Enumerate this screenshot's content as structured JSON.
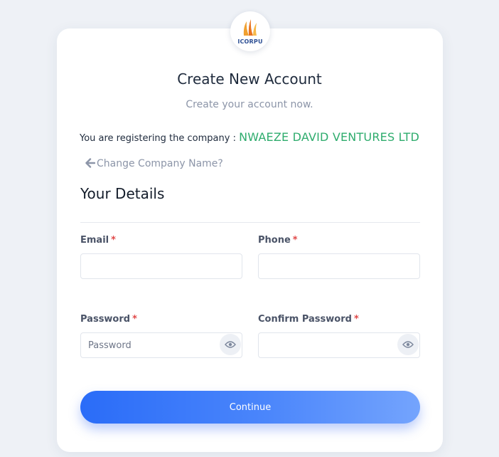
{
  "brand": {
    "logo_text": "ICORPU",
    "accent_color": "#2eac6d",
    "primary_color": "#2a6cf8"
  },
  "header": {
    "title": "Create New Account",
    "subtitle": "Create your account now."
  },
  "company": {
    "prefix": "You are registering the company : ",
    "name": "NWAEZE DAVID VENTURES LTD",
    "change_link": "Change Company Name?",
    "change_icon": "arrow-left-icon"
  },
  "details": {
    "section_title": "Your Details",
    "required_marker": "*",
    "email": {
      "label": "Email",
      "value": "",
      "placeholder": ""
    },
    "phone": {
      "label": "Phone",
      "value": "",
      "placeholder": ""
    },
    "password": {
      "label": "Password",
      "value": "",
      "placeholder": "Password",
      "toggle_icon": "eye-icon"
    },
    "confirm_password": {
      "label": "Confirm Password",
      "value": "",
      "placeholder": "",
      "toggle_icon": "eye-icon"
    }
  },
  "actions": {
    "continue_label": "Continue"
  }
}
